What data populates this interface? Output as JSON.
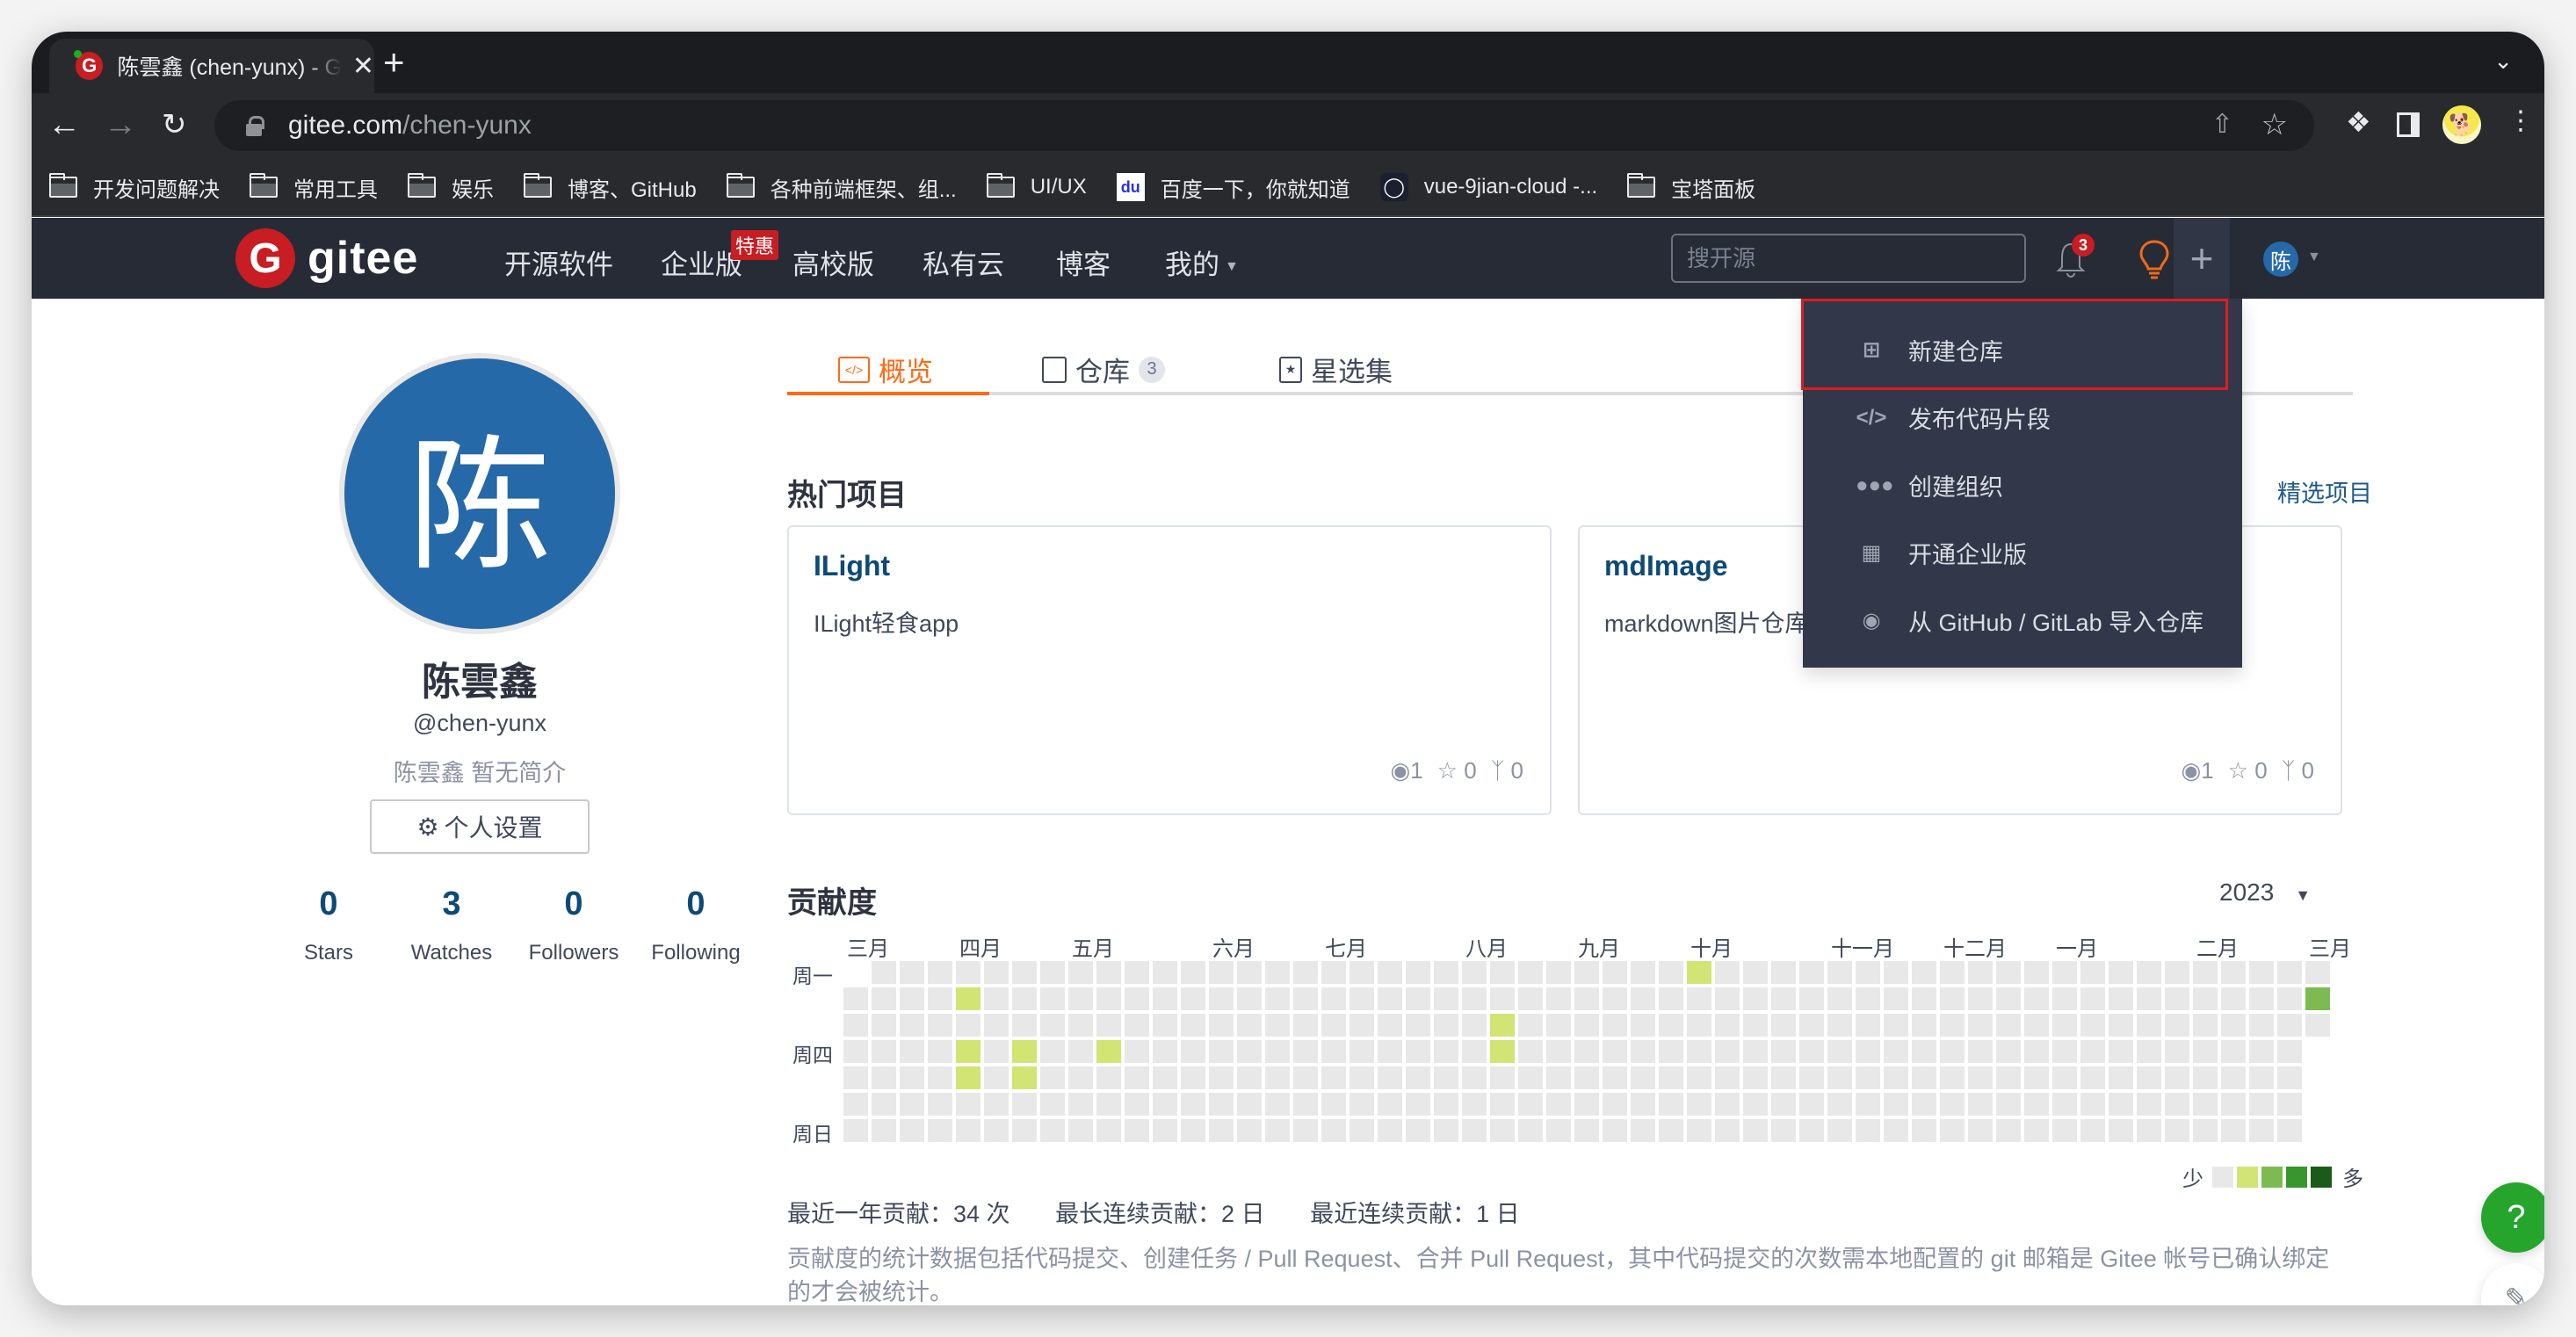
{
  "browser": {
    "tab_title": "陈雲鑫 (chen-yunx) - Gitee.com",
    "tab_close": "✕",
    "new_tab": "+",
    "url_host": "gitee.com",
    "url_path": "/chen-yunx",
    "bookmarks": [
      {
        "label": "开发问题解决",
        "icon": "folder-icon"
      },
      {
        "label": "常用工具",
        "icon": "folder-icon"
      },
      {
        "label": "娱乐",
        "icon": "folder-icon"
      },
      {
        "label": "博客、GitHub",
        "icon": "folder-icon"
      },
      {
        "label": "各种前端框架、组...",
        "icon": "folder-icon"
      },
      {
        "label": "UI/UX",
        "icon": "folder-icon"
      },
      {
        "label": "百度一下，你就知道",
        "icon": "baidu-icon"
      },
      {
        "label": "vue-9jian-cloud -...",
        "icon": "site-icon"
      },
      {
        "label": "宝塔面板",
        "icon": "folder-icon"
      }
    ]
  },
  "gitee_nav": {
    "logo_text": "gitee",
    "menu": [
      "开源软件",
      "企业版",
      "高校版",
      "私有云",
      "博客",
      "我的"
    ],
    "promo_badge": "特惠",
    "search_placeholder": "搜开源",
    "notification_count": "3",
    "user_initial": "陈"
  },
  "create_menu": {
    "items": [
      {
        "label": "新建仓库",
        "icon": "plus-square-icon"
      },
      {
        "label": "发布代码片段",
        "icon": "code-icon"
      },
      {
        "label": "创建组织",
        "icon": "group-icon"
      },
      {
        "label": "开通企业版",
        "icon": "building-icon"
      },
      {
        "label": "从 GitHub / GitLab 导入仓库",
        "icon": "github-icon"
      }
    ],
    "highlighted": "新建仓库"
  },
  "profile": {
    "avatar_initial": "陈",
    "name": "陈雲鑫",
    "handle": "@chen-yunx",
    "bio": "陈雲鑫 暂无简介",
    "settings_label": "个人设置",
    "stats": [
      {
        "value": "0",
        "label": "Stars"
      },
      {
        "value": "3",
        "label": "Watches"
      },
      {
        "value": "0",
        "label": "Followers"
      },
      {
        "value": "0",
        "label": "Following"
      }
    ]
  },
  "tabs": [
    {
      "label": "概览",
      "active": true
    },
    {
      "label": "仓库",
      "count": "3"
    },
    {
      "label": "星选集"
    }
  ],
  "hot_projects": {
    "title": "热门项目",
    "featured_link": "精选项目",
    "items": [
      {
        "name": "ILight",
        "description": "ILight轻食app",
        "watches": "1",
        "stars": "0",
        "forks": "0"
      },
      {
        "name": "mdImage",
        "description": "markdown图片仓库",
        "watches": "1",
        "stars": "0",
        "forks": "0"
      }
    ]
  },
  "contribution": {
    "title": "贡献度",
    "year": "2023",
    "months": [
      {
        "label": "三月",
        "col": 0
      },
      {
        "label": "四月",
        "col": 4
      },
      {
        "label": "五月",
        "col": 8
      },
      {
        "label": "六月",
        "col": 13
      },
      {
        "label": "七月",
        "col": 17
      },
      {
        "label": "八月",
        "col": 22
      },
      {
        "label": "九月",
        "col": 26
      },
      {
        "label": "十月",
        "col": 30
      },
      {
        "label": "十一月",
        "col": 35
      },
      {
        "label": "十二月",
        "col": 39
      },
      {
        "label": "一月",
        "col": 43
      },
      {
        "label": "二月",
        "col": 48
      },
      {
        "label": "三月",
        "col": 52
      }
    ],
    "day_labels": [
      {
        "label": "周一",
        "row": 0
      },
      {
        "label": "周四",
        "row": 3
      },
      {
        "label": "周日",
        "row": 6
      }
    ],
    "weeks": 53,
    "first_week_start_row": 1,
    "last_week_end_row": 2,
    "active_cells": [
      {
        "col": 4,
        "row": 1,
        "level": 1
      },
      {
        "col": 4,
        "row": 3,
        "level": 1
      },
      {
        "col": 4,
        "row": 4,
        "level": 1
      },
      {
        "col": 6,
        "row": 3,
        "level": 1
      },
      {
        "col": 6,
        "row": 4,
        "level": 1
      },
      {
        "col": 9,
        "row": 3,
        "level": 1
      },
      {
        "col": 23,
        "row": 2,
        "level": 1
      },
      {
        "col": 23,
        "row": 3,
        "level": 1
      },
      {
        "col": 30,
        "row": 0,
        "level": 1
      },
      {
        "col": 52,
        "row": 1,
        "level": 2
      }
    ],
    "level_colors": [
      "#e8e8e8",
      "#d2e474",
      "#7dbb52",
      "#38962f",
      "#1c5a1c"
    ],
    "legend_less": "少",
    "legend_more": "多",
    "stats": [
      "最近一年贡献：34 次",
      "最长连续贡献：2 日",
      "最近连续贡献：1 日"
    ],
    "note": "贡献度的统计数据包括代码提交、创建任务 / Pull Request、合并 Pull Request，其中代码提交的次数需本地配置的 git 邮箱是 Gitee 帐号已确认绑定的才会被统计。"
  },
  "floating": {
    "help": "?",
    "feedback_icon": "edit-icon"
  }
}
